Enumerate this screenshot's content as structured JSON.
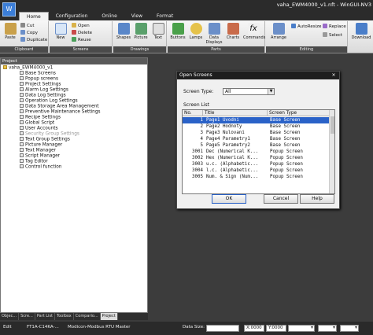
{
  "window": {
    "app_icon": "W",
    "title": "vaha_EWM4000_v1.nft - WinGUI-NV3"
  },
  "ribbon_tabs": [
    "Home",
    "Configuration",
    "Online",
    "View",
    "Format"
  ],
  "ribbon": {
    "clipboard": {
      "caption": "Clipboard",
      "paste": "Paste",
      "cut": "Cut",
      "copy": "Copy",
      "duplicate": "Duplicate"
    },
    "screens": {
      "caption": "Screens",
      "new": "New",
      "open": "Open",
      "delete": "Delete",
      "reuse": "Reuse"
    },
    "drawings": {
      "caption": "Drawings",
      "shapes": "Shapes",
      "picture": "Picture",
      "text": "Text"
    },
    "parts": {
      "caption": "Parts",
      "buttons": "Buttons",
      "lamps": "Lamps",
      "data_displays": "Data Displays",
      "charts": "Charts",
      "commands": "Commands"
    },
    "editing": {
      "caption": "Editing",
      "arrange": "Arrange",
      "autoresize": "AutoResize",
      "replace": "Replace",
      "select": "Select"
    },
    "download": "Download"
  },
  "project_panel": {
    "title": "Project",
    "root": "vaha_EWM4000_v1",
    "items": [
      "Base Screens",
      "Popup screens",
      "Project Settings",
      "Alarm Log Settings",
      "Data Log Settings",
      "Operation Log Settings",
      "Data Storage Area Management",
      "Preventive Maintenance Settings",
      "Recipe Settings",
      "Global Script",
      "User Accounts",
      "Security Group Settings",
      "Text Group Settings",
      "Picture Manager",
      "Text Manager",
      "Script Manager",
      "Tag Editor",
      "Control function"
    ]
  },
  "panel_tabs": [
    "Objec...",
    "Scre...",
    "Part List",
    "Toolbox",
    "Compario...",
    "Project"
  ],
  "status": {
    "mode": "Edit",
    "device": "FT1A-C14KA-...",
    "protocol": "Modicon-Modbus RTU Master",
    "data_size_label": "Data Size:",
    "x": "X:0000",
    "y": "Y:0000"
  },
  "dialog": {
    "title": "Open Screens",
    "close_glyph": "×",
    "screen_type_label": "Screen Type:",
    "screen_type_value": "All",
    "screen_list_label": "Screen List",
    "columns": [
      "No.",
      "Title",
      "Screen Type"
    ],
    "rows": [
      {
        "no": "1",
        "title": "Page1 Uvodni",
        "type": "Base Screen"
      },
      {
        "no": "2",
        "title": "Page2 Hodnoty",
        "type": "Base Screen"
      },
      {
        "no": "3",
        "title": "Page3 Nulovani",
        "type": "Base Screen"
      },
      {
        "no": "4",
        "title": "Page4 Parametry1",
        "type": "Base Screen"
      },
      {
        "no": "5",
        "title": "Page5 Parametry2",
        "type": "Base Screen"
      },
      {
        "no": "3001",
        "title": "Dec (Numerical K...",
        "type": "Popup Screen"
      },
      {
        "no": "3002",
        "title": "Hex (Numerical K...",
        "type": "Popup Screen"
      },
      {
        "no": "3003",
        "title": "u.c. (Alphabetic...",
        "type": "Popup Screen"
      },
      {
        "no": "3004",
        "title": "l.c. (Alphabetic...",
        "type": "Popup Screen"
      },
      {
        "no": "3005",
        "title": "Num. & Sign (Num...",
        "type": "Popup Screen"
      }
    ],
    "ok": "OK",
    "cancel": "Cancel",
    "help": "Help"
  },
  "colors": {
    "accent": "#2a62c8",
    "dark_chrome": "#2b2b2b",
    "panel_bg": "#ffffff"
  }
}
